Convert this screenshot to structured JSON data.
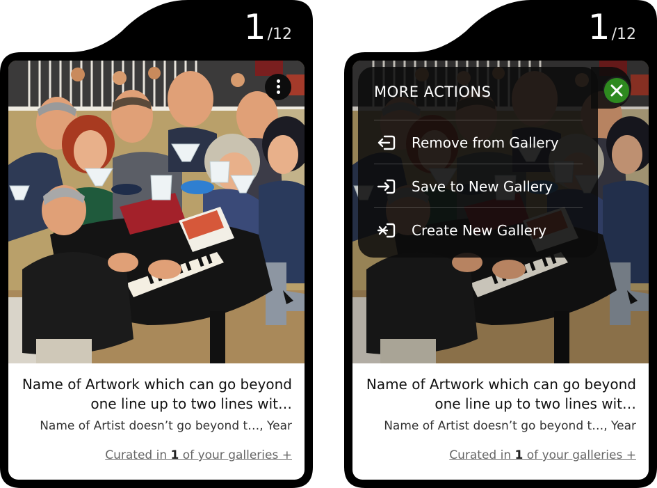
{
  "cards": [
    {
      "counter": {
        "current": "1",
        "total": "/12"
      },
      "title": "Name of Artwork which can go beyond one line up to two lines wit…",
      "artist_line": "Name of Artist doesn’t go beyond t…, Year",
      "curated": {
        "prefix": "Curated in ",
        "count": "1",
        "suffix": " of your galleries +"
      },
      "more_button_icon": "more-vertical-icon"
    },
    {
      "counter": {
        "current": "1",
        "total": "/12"
      },
      "title": "Name of Artwork which can go beyond one line up to two lines wit…",
      "artist_line": "Name of Artist doesn’t go beyond t…, Year",
      "curated": {
        "prefix": "Curated in ",
        "count": "1",
        "suffix": " of your galleries +"
      },
      "menu": {
        "title": "MORE ACTIONS",
        "close_icon": "close-icon",
        "items": [
          {
            "label": "Remove from Gallery",
            "icon": "remove-from-gallery-icon"
          },
          {
            "label": "Save to New Gallery",
            "icon": "save-to-gallery-icon"
          },
          {
            "label": "Create New Gallery",
            "icon": "create-gallery-icon"
          }
        ]
      }
    }
  ],
  "colors": {
    "frame": "#000000",
    "close_button": "#2e8a1f",
    "menu_bg": "#0c0c0c"
  }
}
